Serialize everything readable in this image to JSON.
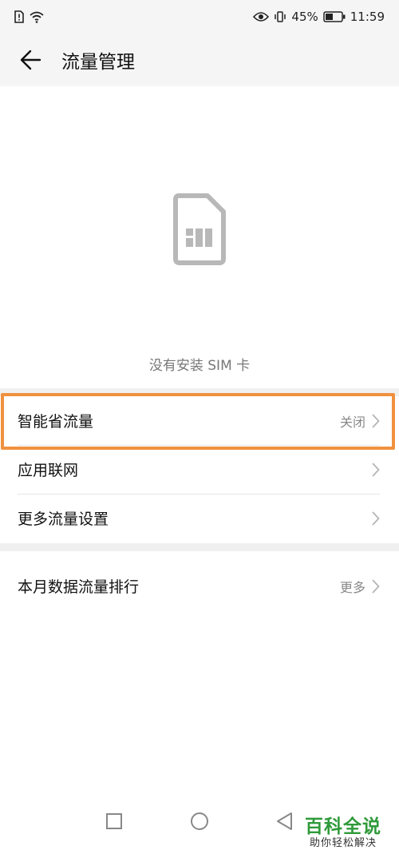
{
  "status_bar": {
    "battery_percent": "45%",
    "time": "11:59",
    "icons": [
      "sim-alert-icon",
      "wifi-icon",
      "eye-icon",
      "vibrate-icon",
      "battery-icon"
    ]
  },
  "app_bar": {
    "title": "流量管理",
    "back_icon": "arrow-left-icon"
  },
  "empty_state": {
    "icon": "sim-card-icon",
    "message": "没有安装 SIM 卡"
  },
  "settings": {
    "items": [
      {
        "label": "智能省流量",
        "value": "关闭",
        "highlighted": true
      },
      {
        "label": "应用联网",
        "value": ""
      },
      {
        "label": "更多流量设置",
        "value": ""
      }
    ]
  },
  "ranking": {
    "label": "本月数据流量排行",
    "value": "更多"
  },
  "nav_bar": {
    "buttons": [
      "recents-square-icon",
      "home-circle-icon",
      "back-triangle-icon"
    ]
  },
  "watermark": {
    "title": "百科全说",
    "subtitle": "助你轻松解决"
  },
  "colors": {
    "highlight": "#f0913f",
    "watermark_green": "#2f9a3a",
    "secondary_text": "#888888",
    "bar_bg": "#f5f5f5"
  }
}
